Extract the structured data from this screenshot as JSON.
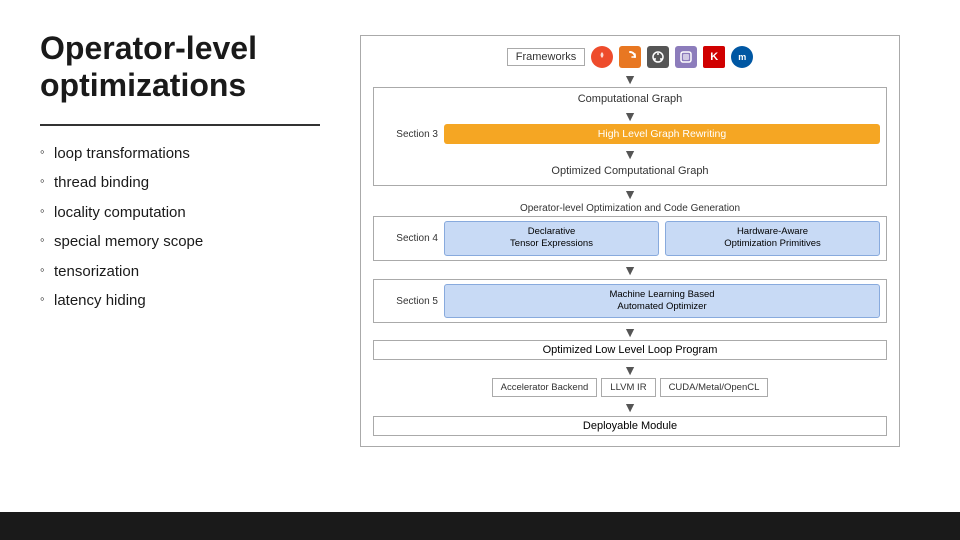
{
  "slide": {
    "title": "Operator-level optimizations"
  },
  "bullets": [
    "loop transformations",
    "thread binding",
    "locality computation",
    "special memory scope",
    "tensorization",
    "latency hiding"
  ],
  "diagram": {
    "frameworks_label": "Frameworks",
    "fw_icons": [
      "pytorch",
      "mxnet",
      "onnx",
      "coreml",
      "keras",
      "mxnet2"
    ],
    "comp_graph": "Computational Graph",
    "section3_label": "Section 3",
    "high_level_rewriting": "High Level Graph Rewriting",
    "opt_comp_graph": "Optimized Computational Graph",
    "op_level_text": "Operator-level Optimization and Code Generation",
    "section4_label": "Section 4",
    "declarative_tensor": "Declarative\nTensor Expressions",
    "hardware_aware": "Hardware-Aware\nOptimization Primitives",
    "section5_label": "Section 5",
    "ml_based": "Machine Learning Based\nAutomated Optimizer",
    "opt_loop": "Optimized Low Level Loop Program",
    "backend_accel": "Accelerator Backend",
    "backend_llvm": "LLVM IR",
    "backend_cuda": "CUDA/Metal/OpenCL",
    "deployable": "Deployable Module"
  }
}
